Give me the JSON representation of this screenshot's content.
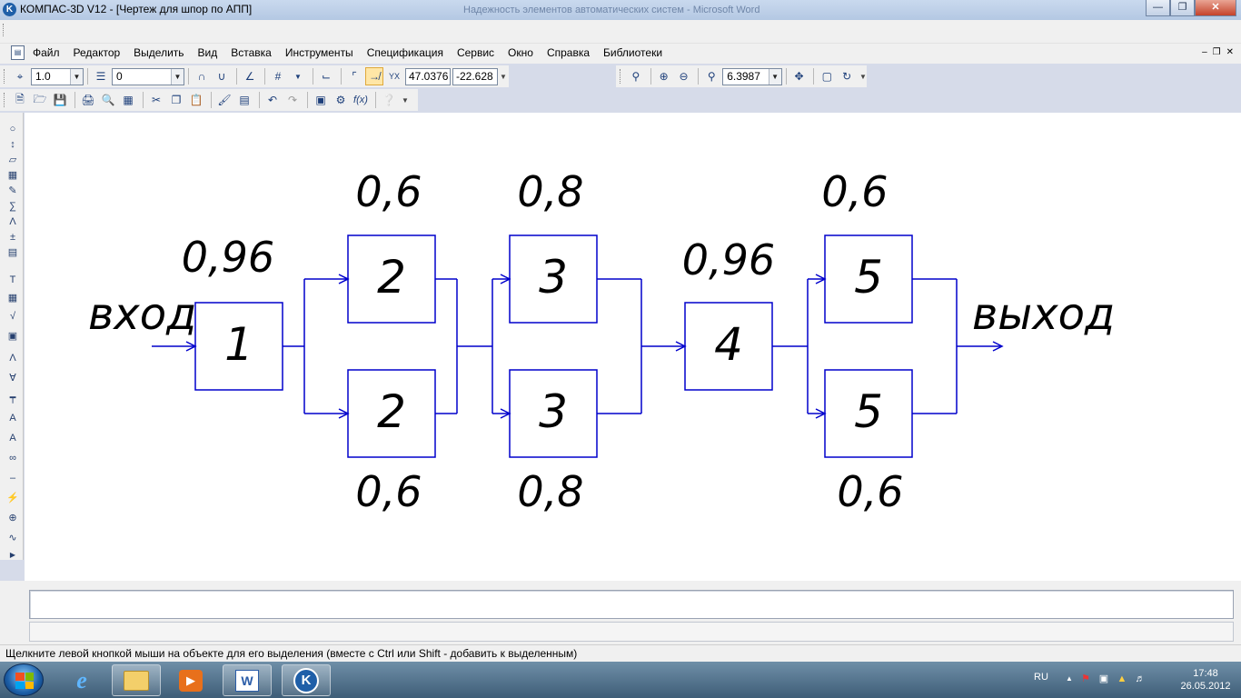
{
  "window": {
    "app_icon": "kompas-logo-icon",
    "title": "КОМПАС-3D V12 - [Чертеж для шпор по АПП]",
    "background_title": "Надежность элементов автоматических систем - Microsoft Word"
  },
  "menu": {
    "items": [
      "Файл",
      "Редактор",
      "Выделить",
      "Вид",
      "Вставка",
      "Инструменты",
      "Спецификация",
      "Сервис",
      "Окно",
      "Справка",
      "Библиотеки"
    ]
  },
  "toolbar": {
    "line_scale": "1.0",
    "layer": "0",
    "coord_x": "47.0376",
    "coord_y": "-22.628",
    "zoom": "6.3987"
  },
  "diagram": {
    "input_label": "вход",
    "output_label": "выход",
    "blocks": {
      "b1": "1",
      "b2_top": "2",
      "b2_bottom": "2",
      "b3_top": "3",
      "b3_bottom": "3",
      "b4": "4",
      "b5_top": "5",
      "b5_bottom": "5"
    },
    "reliability": {
      "r1": "0,96",
      "r2_top": "0,6",
      "r2_bottom": "0,6",
      "r3_top": "0,8",
      "r3_bottom": "0,8",
      "r4": "0,96",
      "r5_top": "0,6",
      "r5_bottom": "0,6"
    },
    "line_color": "#0000cc"
  },
  "status": {
    "message": "Щелкните левой кнопкой мыши на объекте для его выделения (вместе с Ctrl или Shift - добавить к выделенным)"
  },
  "taskbar": {
    "language": "RU",
    "time": "17:48",
    "date": "26.05.2012"
  }
}
